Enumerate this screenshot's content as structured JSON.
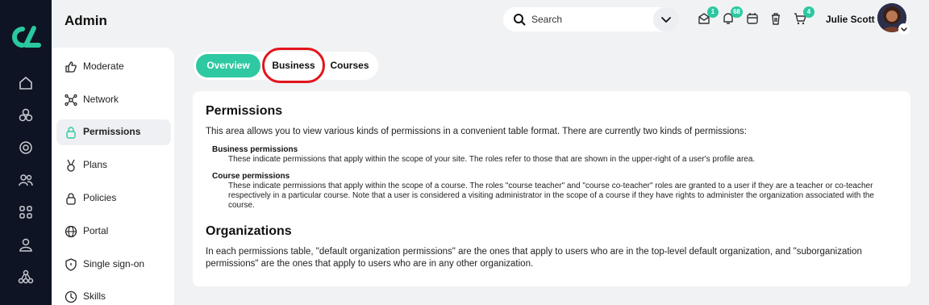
{
  "header": {
    "title": "Admin",
    "search_placeholder": "Search",
    "notifications": [
      {
        "icon": "inbox-icon",
        "badge": "1"
      },
      {
        "icon": "bell-icon",
        "badge": "68"
      },
      {
        "icon": "calendar-icon",
        "badge": ""
      },
      {
        "icon": "trash-icon",
        "badge": ""
      },
      {
        "icon": "cart-icon",
        "badge": "4"
      }
    ],
    "user_name": "Julie Scott"
  },
  "rail": {
    "icons": [
      "home-icon",
      "cubes-icon",
      "target-icon",
      "users-icon",
      "grid-icon",
      "user-icon",
      "network-icon"
    ]
  },
  "sidebar": {
    "items": [
      {
        "label": "Moderate",
        "icon": "thumbs-icon"
      },
      {
        "label": "Network",
        "icon": "network-icon"
      },
      {
        "label": "Permissions",
        "icon": "lock-icon",
        "active": true
      },
      {
        "label": "Plans",
        "icon": "medal-icon"
      },
      {
        "label": "Policies",
        "icon": "padlock-icon"
      },
      {
        "label": "Portal",
        "icon": "globe-icon"
      },
      {
        "label": "Single sign-on",
        "icon": "shield-icon"
      },
      {
        "label": "Skills",
        "icon": "clock-icon"
      }
    ]
  },
  "tabs": [
    {
      "label": "Overview",
      "active": true
    },
    {
      "label": "Business",
      "active": false
    },
    {
      "label": "Courses",
      "active": false
    }
  ],
  "content": {
    "permissions_heading": "Permissions",
    "permissions_intro": "This area allows you to view various kinds of permissions in a convenient table format. There are currently two kinds of permissions:",
    "business_term": "Business permissions",
    "business_desc": "These indicate permissions that apply within the scope of your site. The roles refer to those that are shown in the upper-right of a user's profile area.",
    "course_term": "Course permissions",
    "course_desc": "These indicate permissions that apply within the scope of a course. The roles \"course teacher\" and \"course co-teacher\" roles are granted to a user if they are a teacher or co-teacher respectively in a particular course. Note that a user is considered a visiting administrator in the scope of a course if they have rights to administer the organization associated with the course.",
    "organizations_heading": "Organizations",
    "organizations_text": "In each permissions table, \"default organization permissions\" are the ones that apply to users who are in the top-level default organization, and \"suborganization permissions\" are the ones that apply to users who are in any other organization."
  },
  "colors": {
    "accent": "#2ec9a2",
    "rail": "#0e1423",
    "highlight": "#e3141b"
  }
}
